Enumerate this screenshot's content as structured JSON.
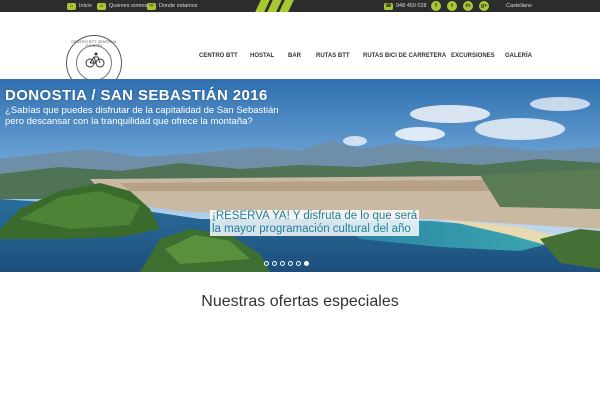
{
  "topbar": {
    "links": [
      {
        "label": "Inicio",
        "icon": "home-icon"
      },
      {
        "label": "Quienes somos",
        "icon": "people-icon"
      },
      {
        "label": "Donde estamos",
        "icon": "mail-icon"
      }
    ],
    "phone": "948 450 028",
    "social": [
      {
        "name": "facebook",
        "glyph": "f"
      },
      {
        "name": "twitter",
        "glyph": "t"
      },
      {
        "name": "linkedin",
        "glyph": "in"
      },
      {
        "name": "google-plus",
        "glyph": "g+"
      }
    ],
    "language": "Castellano"
  },
  "logo": {
    "text": "CENTRO BTT ZENTRUA GOIERRI"
  },
  "nav": {
    "items": [
      "CENTRO BTT",
      "HOSTAL",
      "BAR",
      "RUTAS BTT",
      "RUTAS BICI DE CARRETERA",
      "EXCURSIONES",
      "GALERÍA"
    ]
  },
  "hero": {
    "title": "DONOSTIA / SAN SEBASTIÁN 2016",
    "subtitle_line1": "¿Sabías que puedes disfrutar de la capitalidad de San Sebastián",
    "subtitle_line2": "pero descansar con la tranquilidad que ofrece la montaña?",
    "promo_line1": "¡RESERVA YA! Y disfruta de lo que será",
    "promo_line2": "la mayor programación cultural del año",
    "slides_total": 6,
    "slide_active": 6
  },
  "offers": {
    "title": "Nuestras ofertas especiales"
  },
  "colors": {
    "accent": "#a6c832",
    "topbar_bg": "#2c2c2c",
    "promo_text": "#1f7f9c"
  }
}
